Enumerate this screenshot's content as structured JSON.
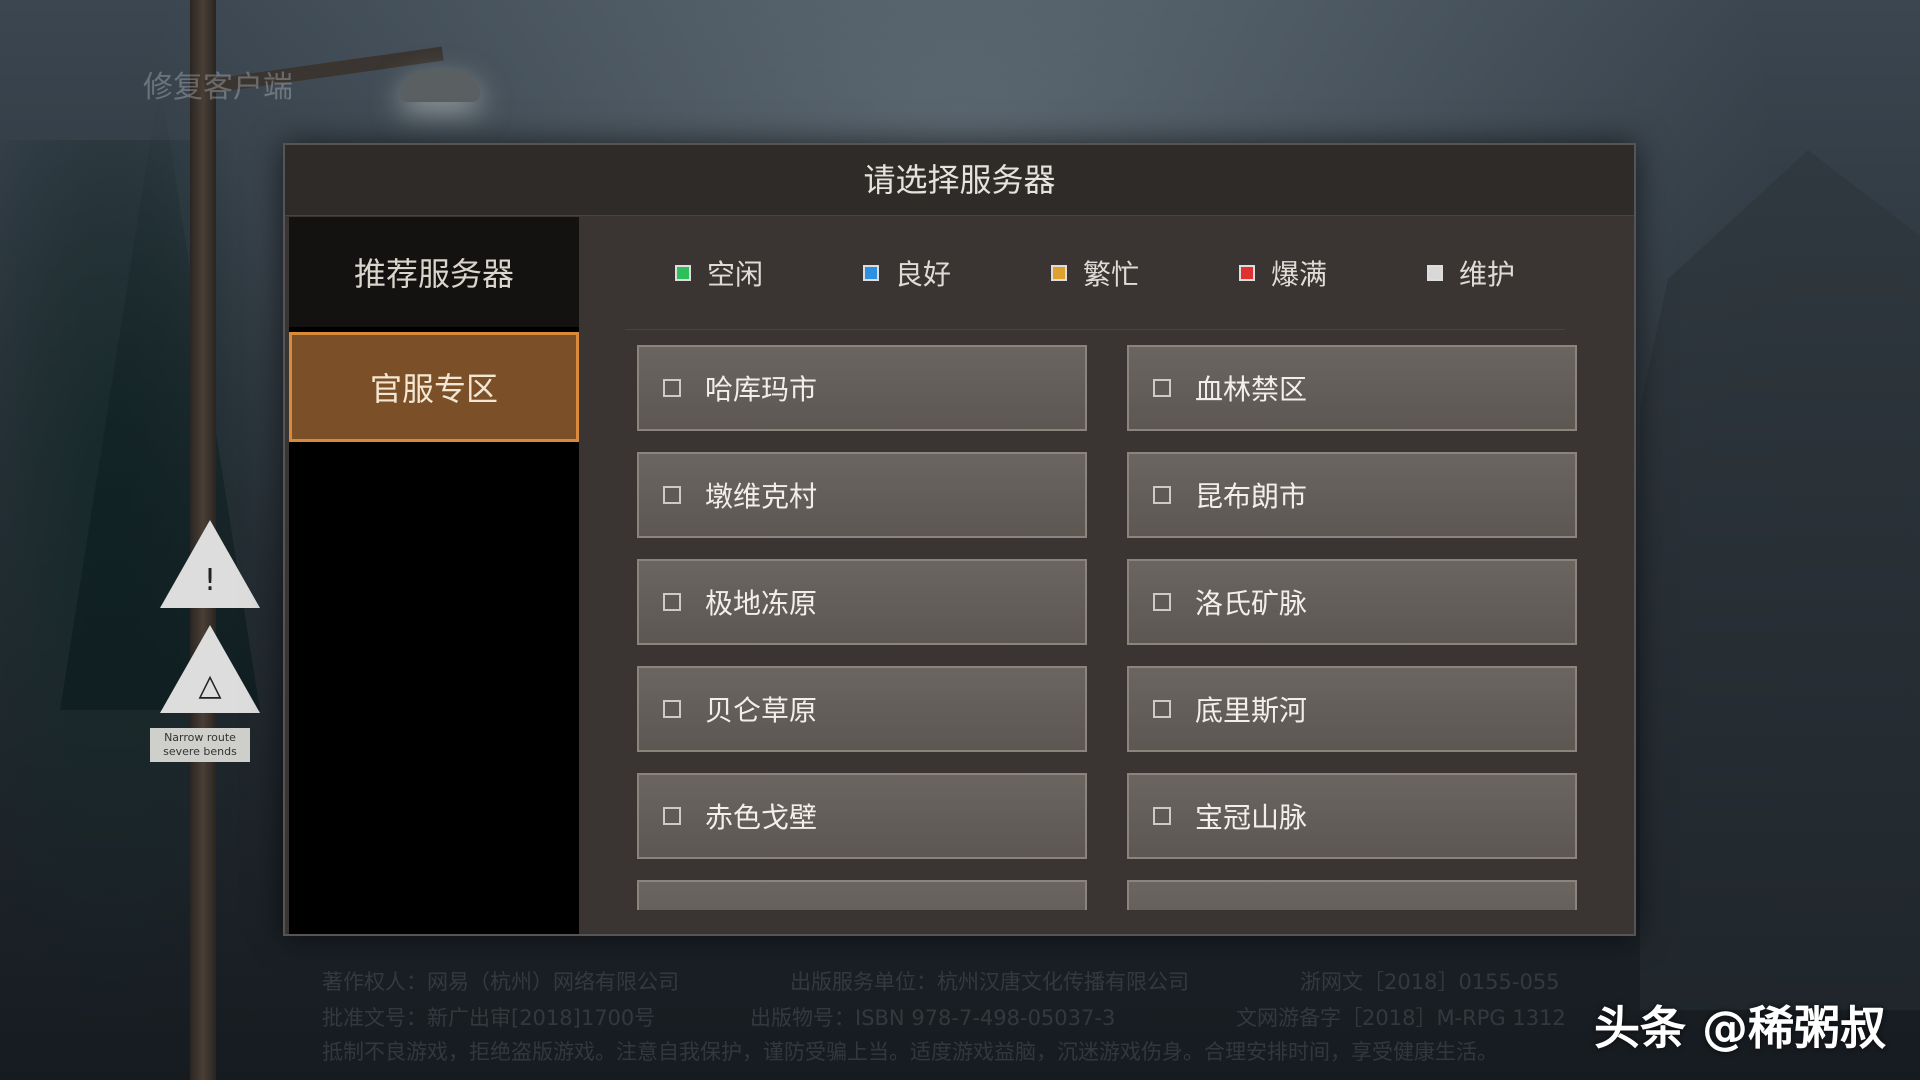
{
  "background": {
    "repair_client": "修复客户端",
    "sign_plate": "Narrow route severe bends"
  },
  "dialog": {
    "title": "请选择服务器",
    "sidebar": {
      "items": [
        {
          "label": "推荐服务器",
          "active": false
        },
        {
          "label": "官服专区",
          "active": true
        }
      ]
    },
    "legend": [
      {
        "label": "空闲",
        "color": "#2fbf5a"
      },
      {
        "label": "良好",
        "color": "#2f8fe0"
      },
      {
        "label": "繁忙",
        "color": "#e0a030"
      },
      {
        "label": "爆满",
        "color": "#e03030"
      },
      {
        "label": "维护",
        "color": "#d8d8d8"
      }
    ],
    "servers": [
      {
        "name": "哈库玛市"
      },
      {
        "name": "血林禁区"
      },
      {
        "name": "墩维克村"
      },
      {
        "name": "昆布朗市"
      },
      {
        "name": "极地冻原"
      },
      {
        "name": "洛氏矿脉"
      },
      {
        "name": "贝仑草原"
      },
      {
        "name": "底里斯河"
      },
      {
        "name": "赤色戈壁"
      },
      {
        "name": "宝冠山脉"
      },
      {
        "name": ""
      },
      {
        "name": ""
      }
    ]
  },
  "footer": {
    "line1_a": "著作权人：网易（杭州）网络有限公司",
    "line1_b": "出版服务单位：杭州汉唐文化传播有限公司",
    "line1_c": "浙网文［2018］0155-055",
    "line2_a": "批准文号：新广出审[2018]1700号",
    "line2_b": "出版物号：ISBN 978-7-498-05037-3",
    "line2_c": "文网游备字［2018］M-RPG 1312",
    "line3": "抵制不良游戏，拒绝盗版游戏。注意自我保护，谨防受骗上当。适度游戏益脑，沉迷游戏伤身。合理安排时间，享受健康生活。"
  },
  "watermark": "头条 @稀粥叔"
}
